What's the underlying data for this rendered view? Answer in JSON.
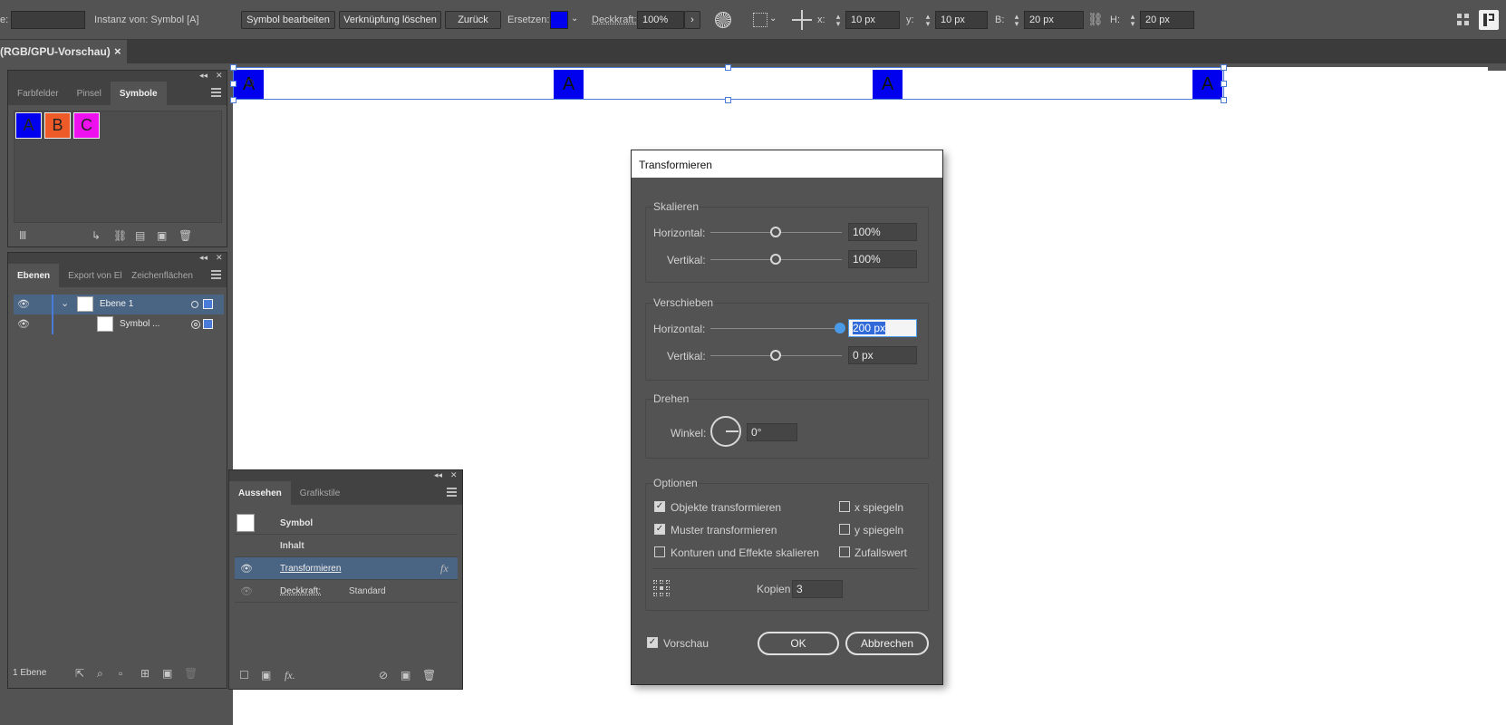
{
  "controlbar": {
    "partial_label": "e:",
    "instance_label": "Instanz von: Symbol [A]",
    "edit_symbol": "Symbol bearbeiten",
    "break_link": "Verknüpfung löschen",
    "back": "Zurück",
    "replace_label": "Ersetzen:",
    "opacity_label": "Deckkraft:",
    "opacity_value": "100%",
    "x_label": "x:",
    "x_value": "10 px",
    "y_label": "y:",
    "y_value": "10 px",
    "w_label": "B:",
    "w_value": "20 px",
    "h_label": "H:",
    "h_value": "20 px"
  },
  "document_tab": {
    "title": "(RGB/GPU-Vorschau)",
    "close": "×"
  },
  "canvas": {
    "symbol_letter": "A",
    "colors": {
      "symbol_blue": "#0000ee",
      "selection": "#4a7bd8"
    }
  },
  "symbols_panel": {
    "tabs": [
      "Farbfelder",
      "Pinsel",
      "Symbole"
    ],
    "active_tab": "Symbole",
    "items": [
      {
        "letter": "A",
        "color": "#0000ee"
      },
      {
        "letter": "B",
        "color": "#ee5a28"
      },
      {
        "letter": "C",
        "color": "#ee10ee"
      }
    ]
  },
  "layers_panel": {
    "tabs": [
      "Ebenen",
      "Export von Ele",
      "Zeichenflächen"
    ],
    "layer_name": "Ebene 1",
    "sublayer_name": "Symbol ...",
    "footer_count": "1 Ebene"
  },
  "appearance_panel": {
    "tabs": [
      "Aussehen",
      "Grafikstile"
    ],
    "rows": {
      "header": "Symbol",
      "content": "Inhalt",
      "transform": "Transformieren",
      "opacity_label": "Deckkraft:",
      "opacity_value": "Standard"
    }
  },
  "dialog": {
    "title": "Transformieren",
    "scale": {
      "group": "Skalieren",
      "horizontal_label": "Horizontal:",
      "horizontal_value": "100%",
      "vertical_label": "Vertikal:",
      "vertical_value": "100%"
    },
    "move": {
      "group": "Verschieben",
      "horizontal_label": "Horizontal:",
      "horizontal_value": "200 px",
      "vertical_label": "Vertikal:",
      "vertical_value": "0 px"
    },
    "rotate": {
      "group": "Drehen",
      "angle_label": "Winkel:",
      "angle_value": "0°"
    },
    "options": {
      "group": "Optionen",
      "transform_objects": "Objekte transformieren",
      "transform_patterns": "Muster transformieren",
      "scale_strokes": "Konturen und Effekte skalieren",
      "reflect_x": "x spiegeln",
      "reflect_y": "y spiegeln",
      "random": "Zufallswert",
      "copies_label": "Kopien",
      "copies_value": "3"
    },
    "preview": "Vorschau",
    "ok": "OK",
    "cancel": "Abbrechen"
  }
}
